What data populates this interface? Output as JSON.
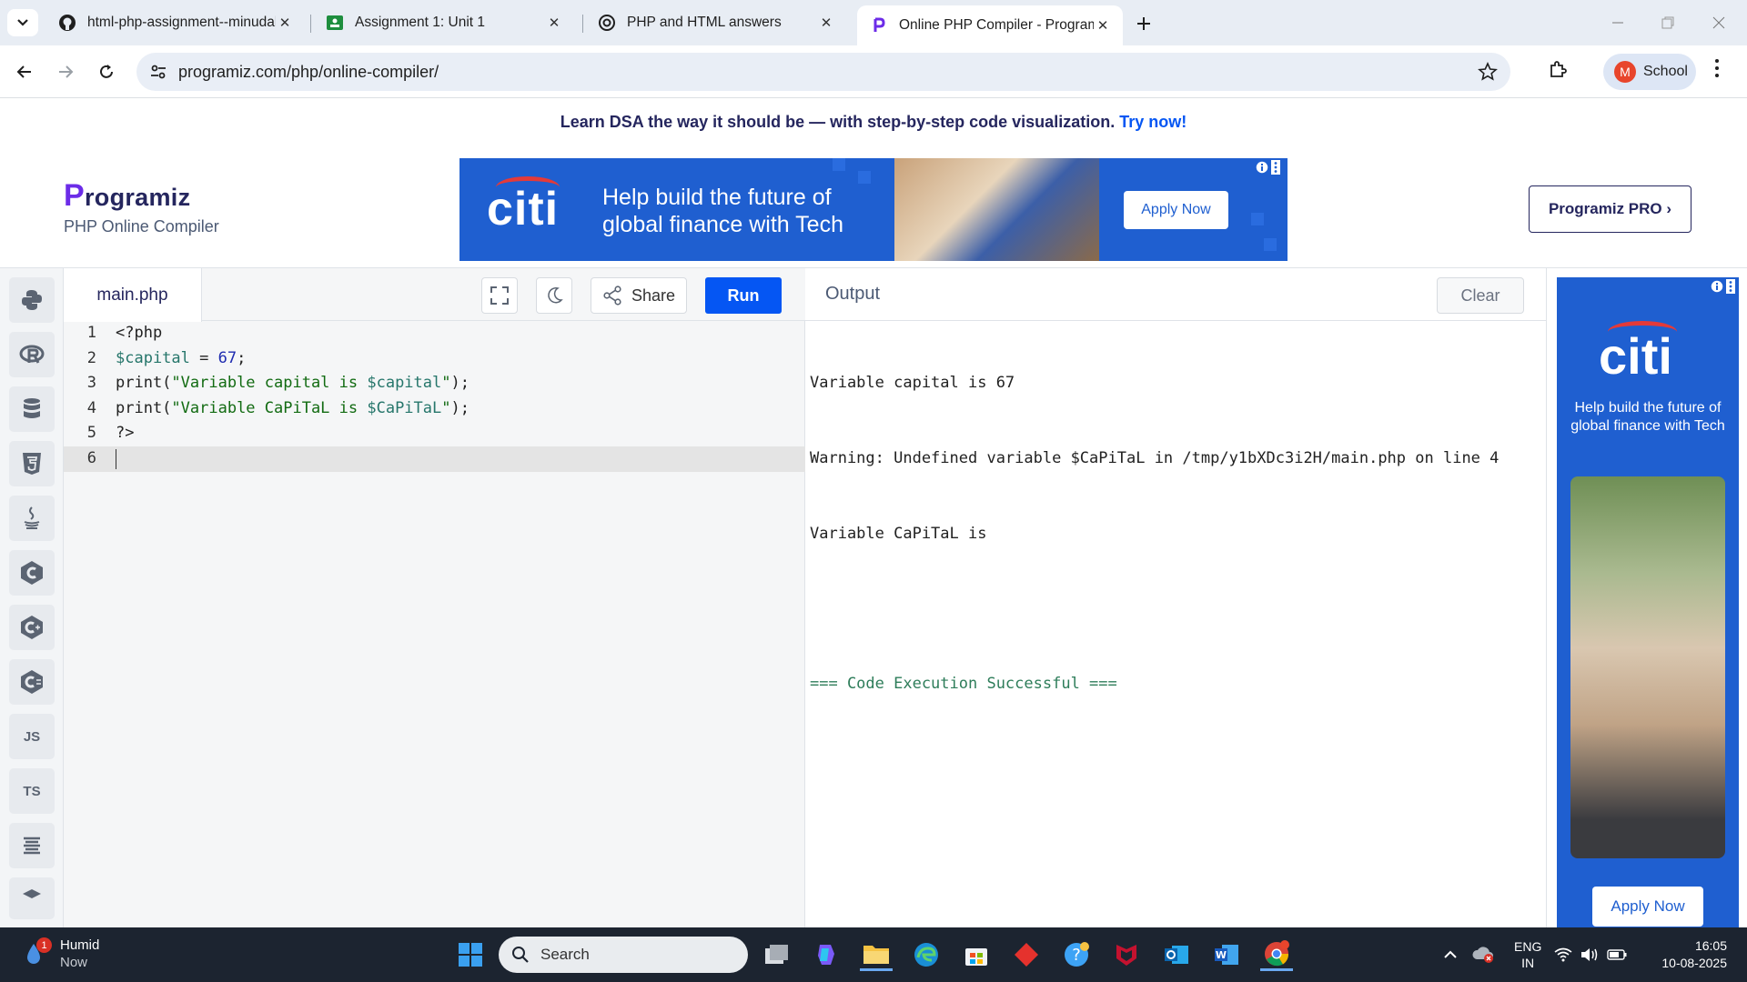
{
  "browser": {
    "tabs": [
      {
        "title": "html-php-assignment--minudal",
        "favicon": "github-icon",
        "active": false
      },
      {
        "title": "Assignment 1: Unit 1",
        "favicon": "classroom-icon",
        "active": false
      },
      {
        "title": "PHP and HTML answers",
        "favicon": "chatgpt-icon",
        "active": false
      },
      {
        "title": "Online PHP Compiler - Programiz",
        "favicon": "programiz-icon",
        "active": true
      }
    ],
    "url": "programiz.com/php/online-compiler/",
    "profile": {
      "initial": "M",
      "label": "School"
    }
  },
  "page": {
    "promo": {
      "text": "Learn DSA the way it should be — with step-by-step code visualization.",
      "link": "Try now!"
    },
    "logo": {
      "brand_first": "P",
      "brand_rest": "rogramiz",
      "subtitle": "PHP Online Compiler"
    },
    "top_ad": {
      "brand": "citi",
      "message_line1": "Help build the future of",
      "message_line2": "global finance with Tech",
      "cta": "Apply Now"
    },
    "pro_button": "Programiz PRO ›"
  },
  "languages": [
    "python",
    "r",
    "sql",
    "html5",
    "java",
    "c",
    "cpp",
    "csharp",
    "JS",
    "TS",
    "go",
    "php"
  ],
  "editor": {
    "file_tab": "main.php",
    "share_label": "Share",
    "run_label": "Run",
    "lines": [
      {
        "n": "1",
        "tokens": [
          {
            "t": "<?php",
            "c": ""
          }
        ]
      },
      {
        "n": "2",
        "tokens": [
          {
            "t": "$capital",
            "c": "c-var"
          },
          {
            "t": " = ",
            "c": ""
          },
          {
            "t": "67",
            "c": "c-num"
          },
          {
            "t": ";",
            "c": ""
          }
        ]
      },
      {
        "n": "3",
        "tokens": [
          {
            "t": "print(",
            "c": ""
          },
          {
            "t": "\"Variable capital is ",
            "c": "c-str"
          },
          {
            "t": "$capital",
            "c": "c-strvar"
          },
          {
            "t": "\"",
            "c": "c-str"
          },
          {
            "t": ");",
            "c": ""
          }
        ]
      },
      {
        "n": "4",
        "tokens": [
          {
            "t": "print(",
            "c": ""
          },
          {
            "t": "\"Variable CaPiTaL is ",
            "c": "c-str"
          },
          {
            "t": "$CaPiTaL",
            "c": "c-strvar"
          },
          {
            "t": "\"",
            "c": "c-str"
          },
          {
            "t": ");",
            "c": ""
          }
        ]
      },
      {
        "n": "5",
        "tokens": [
          {
            "t": "?>",
            "c": ""
          }
        ]
      },
      {
        "n": "6",
        "tokens": []
      }
    ],
    "current_line": "6"
  },
  "output": {
    "title": "Output",
    "clear_label": "Clear",
    "lines": [
      "Variable capital is 67",
      "Warning: Undefined variable $CaPiTaL in /tmp/y1bXDc3i2H/main.php on line 4",
      "Variable CaPiTaL is",
      ""
    ],
    "status": "=== Code Execution Successful ==="
  },
  "side_ad": {
    "brand": "citi",
    "message": "Help build the future of global finance with Tech",
    "cta": "Apply Now"
  },
  "taskbar": {
    "weather": {
      "label": "Humid",
      "time": "Now",
      "badge": "1"
    },
    "search_placeholder": "Search",
    "tray": {
      "lang_line1": "ENG",
      "lang_line2": "IN",
      "time": "16:05",
      "date": "10-08-2025"
    }
  },
  "colors": {
    "accent": "#0556f3",
    "brand_dark": "#25265e",
    "citi_blue": "#1f5fd0",
    "citi_red": "#e43a39"
  }
}
